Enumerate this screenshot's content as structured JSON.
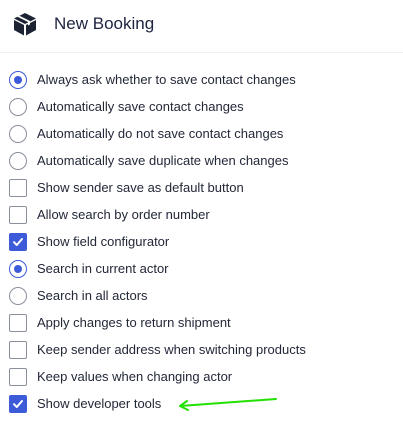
{
  "header": {
    "title": "New Booking",
    "logo_icon": "package-box-icon"
  },
  "options": [
    {
      "label": "Always ask whether to save contact changes",
      "control": "radio",
      "checked": true
    },
    {
      "label": "Automatically save contact changes",
      "control": "radio",
      "checked": false
    },
    {
      "label": "Automatically do not save contact changes",
      "control": "radio",
      "checked": false
    },
    {
      "label": "Automatically save duplicate when changes",
      "control": "radio",
      "checked": false
    },
    {
      "label": "Show sender save as default button",
      "control": "checkbox",
      "checked": false
    },
    {
      "label": "Allow search by order number",
      "control": "checkbox",
      "checked": false
    },
    {
      "label": "Show field configurator",
      "control": "checkbox",
      "checked": true
    },
    {
      "label": "Search in current actor",
      "control": "radio",
      "checked": true
    },
    {
      "label": "Search in all actors",
      "control": "radio",
      "checked": false
    },
    {
      "label": "Apply changes to return shipment",
      "control": "checkbox",
      "checked": false
    },
    {
      "label": "Keep sender address when switching products",
      "control": "checkbox",
      "checked": false
    },
    {
      "label": "Keep values when changing actor",
      "control": "checkbox",
      "checked": false
    },
    {
      "label": "Show developer tools",
      "control": "checkbox",
      "checked": true
    }
  ],
  "annotation": {
    "icon": "green-arrow-icon",
    "color": "#22e000"
  },
  "colors": {
    "accent": "#3d5bd9",
    "text": "#232838",
    "border": "#8a8f9c"
  }
}
